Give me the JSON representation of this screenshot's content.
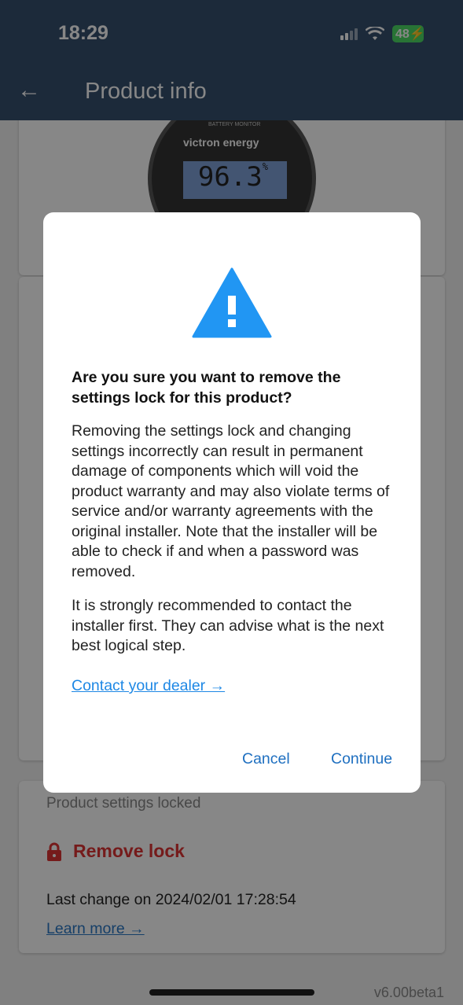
{
  "status_bar": {
    "time": "18:29",
    "battery": "48"
  },
  "header": {
    "title": "Product info",
    "back_icon": "arrow-left-icon"
  },
  "product_image": {
    "label_top": "BATTERY MONITOR",
    "brand": "victron energy",
    "display_value": "96.3",
    "display_unit": "%"
  },
  "lock_card": {
    "label": "Product settings locked",
    "remove_lock": "Remove lock",
    "last_change": "Last change on 2024/02/01 17:28:54",
    "learn_more": "Learn more →"
  },
  "version": "v6.00beta1",
  "dialog": {
    "icon": "warning-triangle-icon",
    "title": "Are you sure you want to remove the settings lock for this product?",
    "paragraph1": "Removing the settings lock and changing settings incorrectly can result in permanent damage of components which will void the product warranty and may also violate terms of service and/or warranty agreements with the original installer. Note that the installer will be able to check if and when a password was removed.",
    "paragraph2": "It is strongly recommended to contact the installer first. They can advise what is the next best logical step.",
    "contact_link": "Contact your dealer →",
    "cancel": "Cancel",
    "continue": "Continue"
  },
  "colors": {
    "header": "#36506e",
    "accent": "#1e88e5",
    "danger": "#d33333",
    "warning": "#2196f3"
  }
}
